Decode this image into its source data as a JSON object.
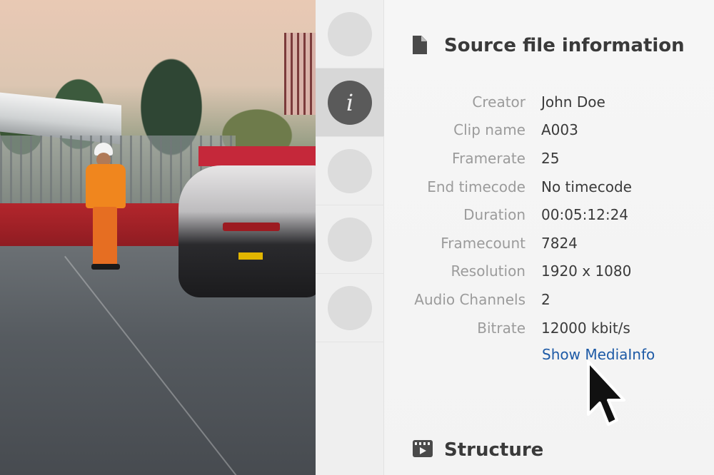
{
  "info_panel": {
    "title": "Source file information",
    "title_icon": "document-icon",
    "fields": [
      {
        "label": "Creator",
        "value": "John Doe"
      },
      {
        "label": "Clip name",
        "value": "A003"
      },
      {
        "label": "Framerate",
        "value": "25"
      },
      {
        "label": "End timecode",
        "value": "No timecode"
      },
      {
        "label": "Duration",
        "value": "00:05:12:24"
      },
      {
        "label": "Framecount",
        "value": "7824"
      },
      {
        "label": "Resolution",
        "value": "1920 x 1080"
      },
      {
        "label": "Audio Channels",
        "value": "2"
      },
      {
        "label": "Bitrate",
        "value": "12000 kbit/s"
      }
    ],
    "link_label": "Show MediaInfo",
    "link_color": "#1d5aa6"
  },
  "structure_section": {
    "title": "Structure",
    "icon": "film-icon"
  },
  "rail": {
    "items": [
      {
        "icon": "placeholder-circle-icon",
        "active": false
      },
      {
        "icon": "info-icon",
        "glyph": "i",
        "active": true
      },
      {
        "icon": "placeholder-circle-icon",
        "active": false
      },
      {
        "icon": "placeholder-circle-icon",
        "active": false
      },
      {
        "icon": "placeholder-circle-icon",
        "active": false
      }
    ]
  },
  "preview": {
    "subject": "race car on track with track marshal"
  },
  "colors": {
    "accent_link": "#1d5aa6",
    "rail_active": "#d7d7d7",
    "info_icon_bg": "#5a5a5a"
  }
}
